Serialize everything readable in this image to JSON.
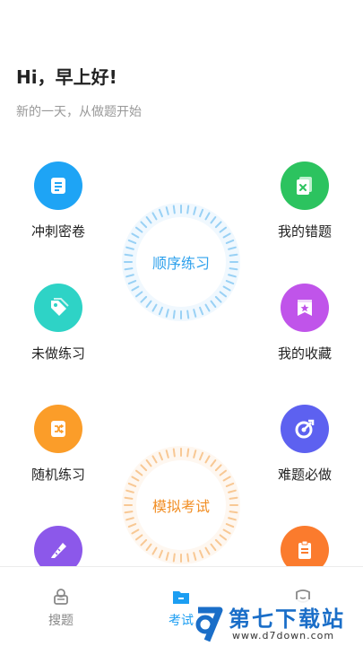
{
  "header": {
    "greeting": "Hi，早上好!",
    "subtitle": "新的一天，从做题开始"
  },
  "tiles": [
    {
      "label": "冲刺密卷",
      "icon": "document-icon",
      "color": "#1ea4f5"
    },
    {
      "label": "我的错题",
      "icon": "wrong-questions-icon",
      "color": "#2cc35f"
    },
    {
      "label": "未做练习",
      "icon": "tag-icon",
      "color": "#2ed3c6"
    },
    {
      "label": "我的收藏",
      "icon": "bookmark-star-icon",
      "color": "#c054ea"
    },
    {
      "label": "随机练习",
      "icon": "shuffle-icon",
      "color": "#fb9d29"
    },
    {
      "label": "难题必做",
      "icon": "target-icon",
      "color": "#5d61f0"
    },
    {
      "label": "",
      "icon": "pencil-ruler-icon",
      "color": "#8c58ea"
    },
    {
      "label": "",
      "icon": "clipboard-icon",
      "color": "#fb7b2d"
    }
  ],
  "center": {
    "practice_label": "顺序练习",
    "practice_color": "#2fa1ec",
    "exam_label": "模拟考试",
    "exam_color": "#f18e24"
  },
  "tabbar": {
    "tabs": [
      {
        "label": "搜题",
        "icon": "search-question-icon"
      },
      {
        "label": "考试",
        "icon": "exam-folder-icon",
        "active": true
      },
      {
        "label": "",
        "icon": "profile-icon"
      }
    ],
    "accent": "#1c9ef2"
  },
  "watermark": {
    "title": "第七下载站",
    "url": "www.d7down.com"
  }
}
